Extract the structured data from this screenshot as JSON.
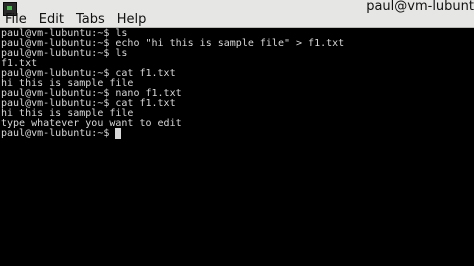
{
  "window": {
    "title": "paul@vm-lubunt"
  },
  "menubar": {
    "items": [
      {
        "label": "File"
      },
      {
        "label": "Edit"
      },
      {
        "label": "Tabs"
      },
      {
        "label": "Help"
      }
    ]
  },
  "terminal": {
    "lines": [
      "paul@vm-lubuntu:~$ ls",
      "paul@vm-lubuntu:~$ echo \"hi this is sample file\" > f1.txt",
      "paul@vm-lubuntu:~$ ls",
      "f1.txt",
      "paul@vm-lubuntu:~$ cat f1.txt",
      "hi this is sample file",
      "paul@vm-lubuntu:~$ nano f1.txt",
      "paul@vm-lubuntu:~$ cat f1.txt",
      "hi this is sample file",
      "type whatever you want to edit"
    ],
    "prompt": "paul@vm-lubuntu:~$ "
  },
  "colors": {
    "background": "#000000",
    "foreground": "#d8d8d8",
    "menubar": "#e6e6e4"
  },
  "icons": {
    "app": "terminal-icon"
  }
}
